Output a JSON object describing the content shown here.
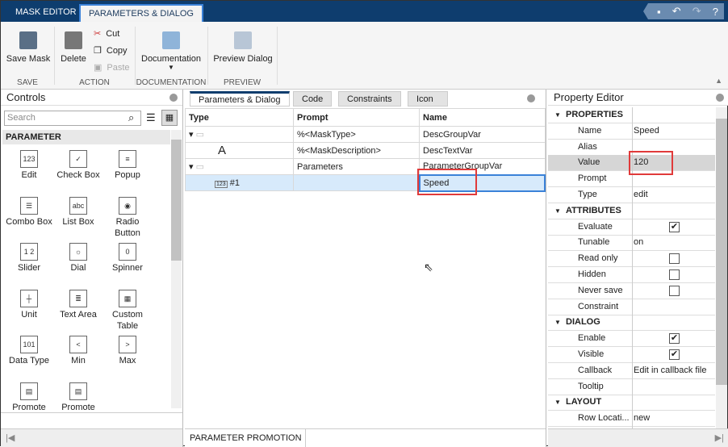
{
  "top_tabs": [
    "MASK EDITOR",
    "PARAMETERS & DIALOG"
  ],
  "ribbon": {
    "save_mask": "Save Mask",
    "delete": "Delete",
    "cut": "Cut",
    "copy": "Copy",
    "paste": "Paste",
    "documentation": "Documentation",
    "preview_dialog": "Preview Dialog",
    "sections": [
      "SAVE",
      "ACTION",
      "DOCUMENTATION",
      "PREVIEW"
    ]
  },
  "controls": {
    "title": "Controls",
    "search_placeholder": "Search",
    "section": "PARAMETER",
    "items": [
      {
        "label": "Edit",
        "glyph": "123"
      },
      {
        "label": "Check Box",
        "glyph": "✓"
      },
      {
        "label": "Popup",
        "glyph": "≡"
      },
      {
        "label": "Combo Box",
        "glyph": "☰"
      },
      {
        "label": "List Box",
        "glyph": "abc"
      },
      {
        "label": "Radio Button",
        "glyph": "◉"
      },
      {
        "label": "Slider",
        "glyph": "1 2"
      },
      {
        "label": "Dial",
        "glyph": "☼"
      },
      {
        "label": "Spinner",
        "glyph": "0"
      },
      {
        "label": "Unit",
        "glyph": "┼"
      },
      {
        "label": "Text Area",
        "glyph": "≣"
      },
      {
        "label": "Custom Table",
        "glyph": "▦"
      },
      {
        "label": "Data Type",
        "glyph": "101"
      },
      {
        "label": "Min",
        "glyph": "<"
      },
      {
        "label": "Max",
        "glyph": ">"
      },
      {
        "label": "Promote",
        "glyph": "▤"
      },
      {
        "label": "Promote",
        "glyph": "▤"
      }
    ]
  },
  "center": {
    "tabs": [
      "Parameters & Dialog",
      "Code",
      "Constraints",
      "Icon"
    ],
    "columns": [
      "Type",
      "Prompt",
      "Name"
    ],
    "rows": [
      {
        "type": "group",
        "prompt": "%<MaskType>",
        "name": "DescGroupVar"
      },
      {
        "type": "A",
        "prompt": "%<MaskDescription>",
        "name": "DescTextVar"
      },
      {
        "type": "group",
        "prompt": "Parameters",
        "name": "ParameterGroupVar"
      },
      {
        "type": "#1",
        "prompt": "",
        "name": "Speed"
      }
    ],
    "bottom_tab": "PARAMETER PROMOTION"
  },
  "property_editor": {
    "title": "Property Editor",
    "rows": [
      {
        "cat": "PROPERTIES"
      },
      {
        "label": "Name",
        "value": "Speed"
      },
      {
        "label": "Alias",
        "value": ""
      },
      {
        "label": "Value",
        "value": "120"
      },
      {
        "label": "Prompt",
        "value": ""
      },
      {
        "label": "Type",
        "value": "edit"
      },
      {
        "cat": "ATTRIBUTES"
      },
      {
        "label": "Evaluate",
        "check": true
      },
      {
        "label": "Tunable",
        "value": "on"
      },
      {
        "label": "Read only",
        "check": false
      },
      {
        "label": "Hidden",
        "check": false
      },
      {
        "label": "Never save",
        "check": false
      },
      {
        "label": "Constraint",
        "value": ""
      },
      {
        "cat": "DIALOG"
      },
      {
        "label": "Enable",
        "check": true
      },
      {
        "label": "Visible",
        "check": true
      },
      {
        "label": "Callback",
        "value": "Edit in callback file"
      },
      {
        "label": "Tooltip",
        "value": ""
      },
      {
        "cat": "LAYOUT"
      },
      {
        "label": "Row Locati...",
        "value": "new"
      }
    ]
  }
}
